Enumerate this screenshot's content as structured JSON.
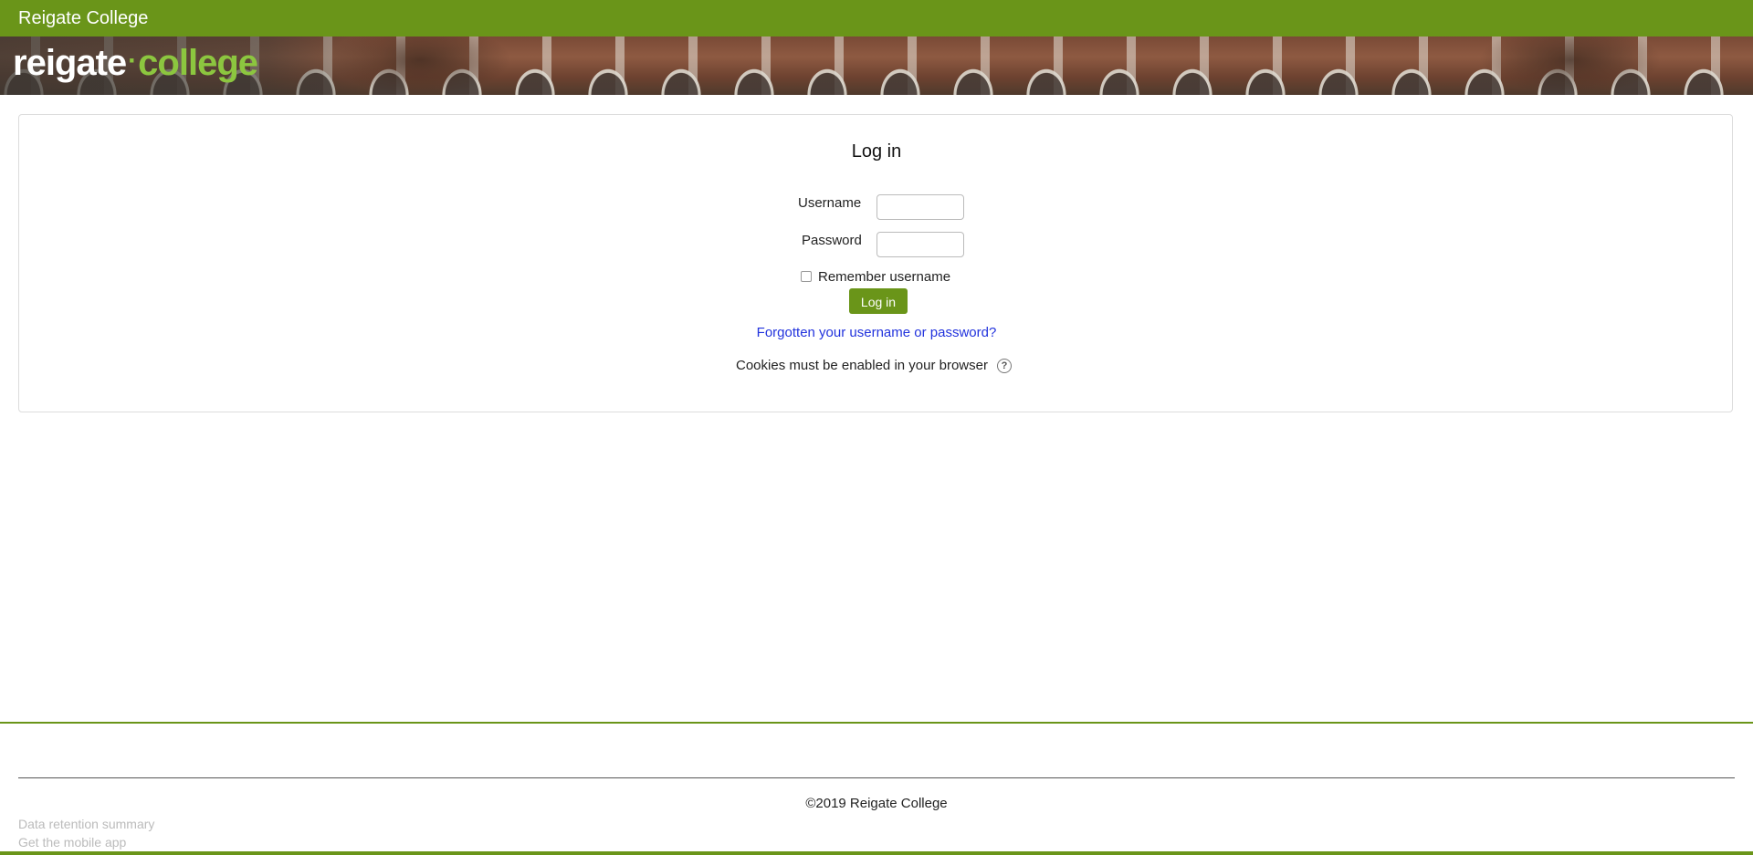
{
  "header": {
    "site_name": "Reigate College"
  },
  "banner": {
    "logo_word1": "reigate",
    "logo_separator": "·",
    "logo_word2": "college"
  },
  "login": {
    "title": "Log in",
    "username_label": "Username",
    "username_value": "",
    "password_label": "Password",
    "password_value": "",
    "remember_label": "Remember username",
    "remember_checked": false,
    "submit_label": "Log in",
    "forgot_link": "Forgotten your username or password?",
    "cookies_notice": "Cookies must be enabled in your browser",
    "help_icon": "question-circle-icon"
  },
  "footer": {
    "copyright": "©2019 Reigate College",
    "links": [
      "Data retention summary",
      "Get the mobile app"
    ]
  },
  "colors": {
    "brand_green": "#6a9519",
    "logo_green": "#8cc63f",
    "link_blue": "#2233dd"
  }
}
